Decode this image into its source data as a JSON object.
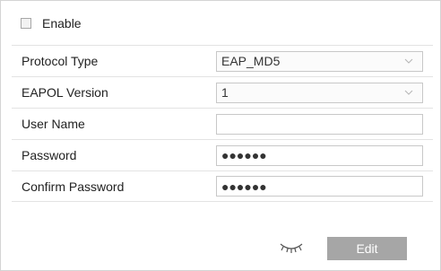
{
  "enable": {
    "label": "Enable",
    "checked": false
  },
  "form": {
    "protocol_type": {
      "label": "Protocol Type",
      "value": "EAP_MD5"
    },
    "eapol_version": {
      "label": "EAPOL Version",
      "value": "1"
    },
    "user_name": {
      "label": "User Name",
      "value": ""
    },
    "password": {
      "label": "Password",
      "value": "●●●●●●"
    },
    "confirm_password": {
      "label": "Confirm Password",
      "value": "●●●●●●"
    }
  },
  "actions": {
    "edit_label": "Edit",
    "eye_icon": "eye-closed-icon"
  },
  "colors": {
    "button_bg": "#a6a6a6",
    "border": "#c8c8c8",
    "divider": "#e3e3e3"
  }
}
